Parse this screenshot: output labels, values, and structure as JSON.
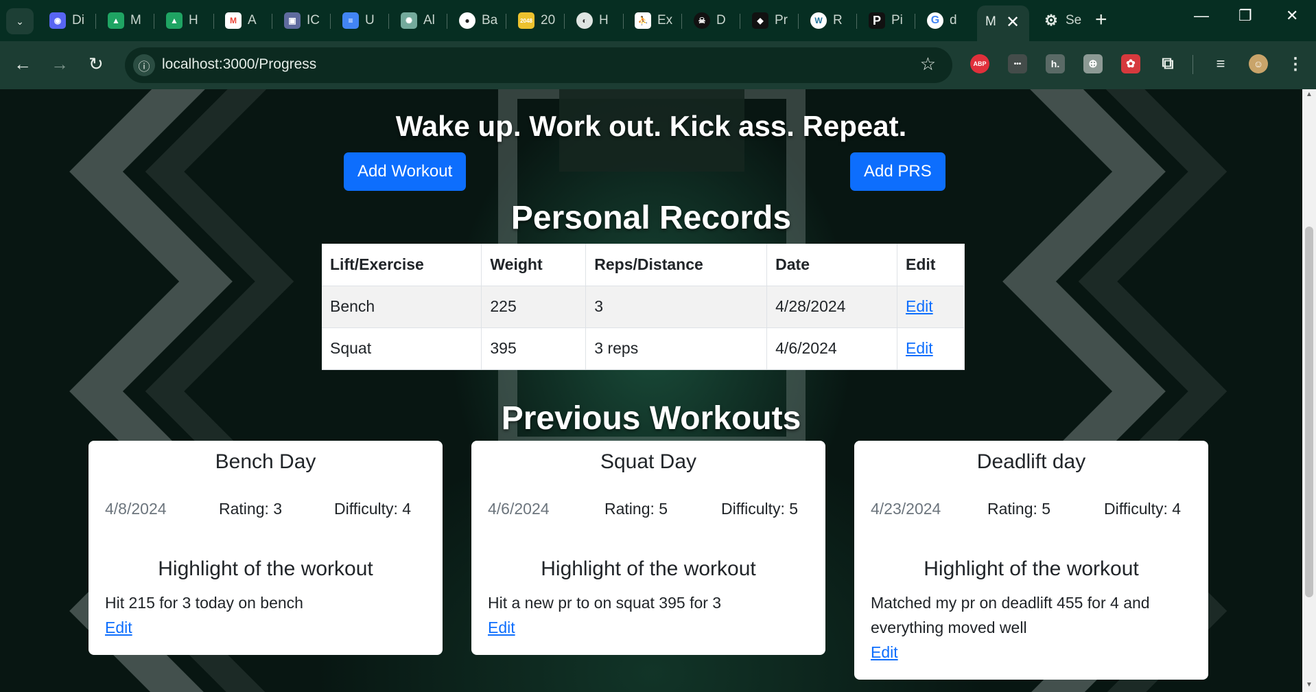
{
  "browser": {
    "tabs": [
      {
        "label": "Di",
        "icon": "discord-icon",
        "color": "#5865f2"
      },
      {
        "label": "M",
        "icon": "google-drive-icon",
        "color": "#1fa463"
      },
      {
        "label": "H",
        "icon": "google-drive-icon",
        "color": "#1fa463"
      },
      {
        "label": "A",
        "icon": "gmail-icon",
        "color": "#ea4335"
      },
      {
        "label": "IC",
        "icon": "document-icon",
        "color": "#5f6b9e"
      },
      {
        "label": "U",
        "icon": "google-docs-icon",
        "color": "#4285f4"
      },
      {
        "label": "Al",
        "icon": "chatgpt-icon",
        "color": "#74aa9c"
      },
      {
        "label": "Ba",
        "icon": "github-icon",
        "color": "#222222"
      },
      {
        "label": "20",
        "icon": "2048-icon",
        "color": "#edc22e"
      },
      {
        "label": "H",
        "icon": "globe-icon",
        "color": "#4a5a55"
      },
      {
        "label": "Ex",
        "icon": "runner-icon",
        "color": "#ffffff"
      },
      {
        "label": "D",
        "icon": "skull-icon",
        "color": "#222222"
      },
      {
        "label": "Pr",
        "icon": "panther-icon",
        "color": "#111111"
      },
      {
        "label": "R",
        "icon": "wordpress-icon",
        "color": "#21759b"
      },
      {
        "label": "Pi",
        "icon": "p-logo-icon",
        "color": "#111111"
      },
      {
        "label": "d",
        "icon": "google-icon",
        "color": "#ffffff"
      }
    ],
    "active_tab": {
      "label": "M",
      "close": "✕"
    },
    "settings_tab": {
      "label": "Se",
      "icon": "gear-icon"
    },
    "new_tab": "+",
    "url": "localhost:3000/Progress",
    "extensions": [
      {
        "label": "ABP",
        "icon": "adblock-icon",
        "color": "#e0303b"
      },
      {
        "label": "•••",
        "icon": "ellipsis-extension-icon",
        "color": "#444c4a"
      },
      {
        "label": "h.",
        "icon": "honey-icon",
        "color": "#5a6a66"
      },
      {
        "label": "⊕",
        "icon": "extension-icon",
        "color": "#8d9a95"
      },
      {
        "label": "✿",
        "icon": "red-extension-icon",
        "color": "#d6393d"
      }
    ]
  },
  "page": {
    "motto": "Wake up. Work out. Kick ass. Repeat.",
    "add_workout_label": "Add Workout",
    "add_prs_label": "Add PRS",
    "records_title": "Personal Records",
    "records": {
      "headers": [
        "Lift/Exercise",
        "Weight",
        "Reps/Distance",
        "Date",
        "Edit"
      ],
      "rows": [
        {
          "lift": "Bench",
          "weight": "225",
          "reps": "3",
          "date": "4/28/2024",
          "edit": "Edit"
        },
        {
          "lift": "Squat",
          "weight": "395",
          "reps": "3 reps",
          "date": "4/6/2024",
          "edit": "Edit"
        }
      ]
    },
    "workouts_title": "Previous Workouts",
    "workouts": [
      {
        "title": "Bench Day",
        "date": "4/8/2024",
        "rating": "Rating: 3",
        "difficulty": "Difficulty: 4",
        "highlight_title": "Highlight of the workout",
        "highlight": "Hit 215 for 3 today on bench",
        "edit": "Edit"
      },
      {
        "title": "Squat Day",
        "date": "4/6/2024",
        "rating": "Rating: 5",
        "difficulty": "Difficulty: 5",
        "highlight_title": "Highlight of the workout",
        "highlight": "Hit a new pr to on squat 395 for 3",
        "edit": "Edit"
      },
      {
        "title": "Deadlift day",
        "date": "4/23/2024",
        "rating": "Rating: 5",
        "difficulty": "Difficulty: 4",
        "highlight_title": "Highlight of the workout",
        "highlight": "Matched my pr on deadlift 455 for 4 and everything moved well",
        "edit": "Edit"
      }
    ]
  }
}
